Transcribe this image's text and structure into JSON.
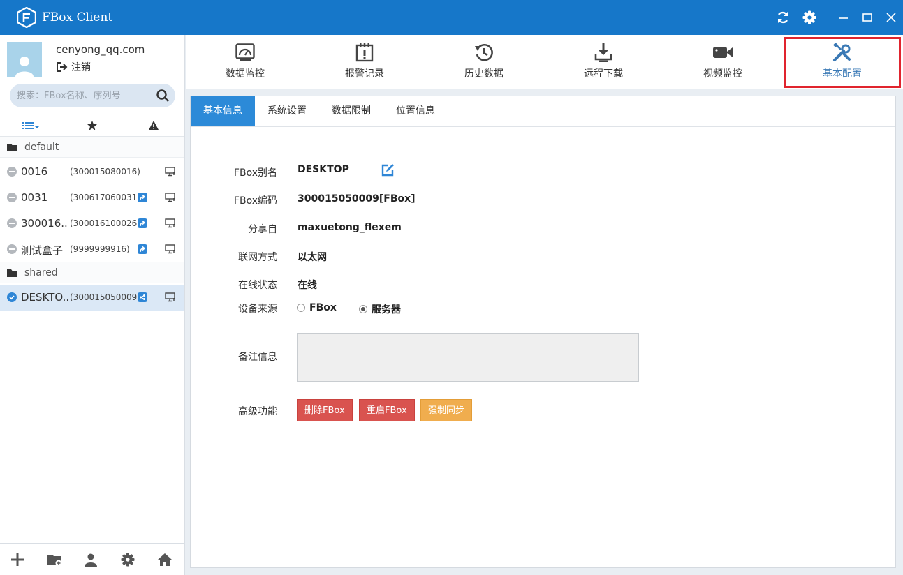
{
  "window": {
    "title": "FBox Client",
    "controls": [
      "refresh-icon",
      "gear-icon",
      "minimize-icon",
      "maximize-icon",
      "close-icon"
    ]
  },
  "user": {
    "name": "cenyong_qq.com",
    "logout_label": "注销"
  },
  "search": {
    "placeholder": "搜索：FBox名称、序列号"
  },
  "sidebar": {
    "groups": [
      {
        "name": "default",
        "devices": [
          {
            "name": "0016",
            "serial": "(300015080016)",
            "shared": false
          },
          {
            "name": "0031",
            "serial": "(300617060031)",
            "shared": true
          },
          {
            "name": "300016..",
            "serial": "(300016100026)",
            "shared": true
          },
          {
            "name": "测试盒子",
            "serial": "(9999999916)",
            "shared": true
          }
        ]
      },
      {
        "name": "shared",
        "devices": [
          {
            "name": "DESKTO..",
            "serial": "(300015050009)",
            "shared": true,
            "selected": true
          }
        ]
      }
    ]
  },
  "topnav": {
    "items": [
      {
        "label": "数据监控",
        "icon": "dashboard-icon"
      },
      {
        "label": "报警记录",
        "icon": "alarm-log-icon"
      },
      {
        "label": "历史数据",
        "icon": "history-icon"
      },
      {
        "label": "远程下载",
        "icon": "download-icon"
      },
      {
        "label": "视频监控",
        "icon": "camera-icon"
      },
      {
        "label": "基本配置",
        "icon": "tools-icon",
        "active": true
      }
    ]
  },
  "tabs": [
    {
      "label": "基本信息",
      "active": true
    },
    {
      "label": "系统设置"
    },
    {
      "label": "数据限制"
    },
    {
      "label": "位置信息"
    }
  ],
  "info": {
    "alias_label": "FBox别名",
    "alias_value": "DESKTOP",
    "code_label": "FBox编码",
    "code_value": "300015050009[FBox]",
    "share_label": "分享自",
    "share_value": "maxuetong_flexem",
    "network_label": "联网方式",
    "network_value": "以太网",
    "status_label": "在线状态",
    "status_value": "在线",
    "source_label": "设备来源",
    "source_options": [
      "FBox",
      "服务器"
    ],
    "source_selected": "服务器",
    "note_label": "备注信息",
    "note_value": "",
    "advanced_label": "高级功能"
  },
  "actions": {
    "delete": "删除FBox",
    "restart": "重启FBox",
    "sync": "强制同步"
  },
  "colors": {
    "titlebar": "#1677c9",
    "accent": "#2c8ad8",
    "danger": "#d9534f",
    "warning": "#f0ad4e",
    "highlight_frame": "#e0242e"
  }
}
